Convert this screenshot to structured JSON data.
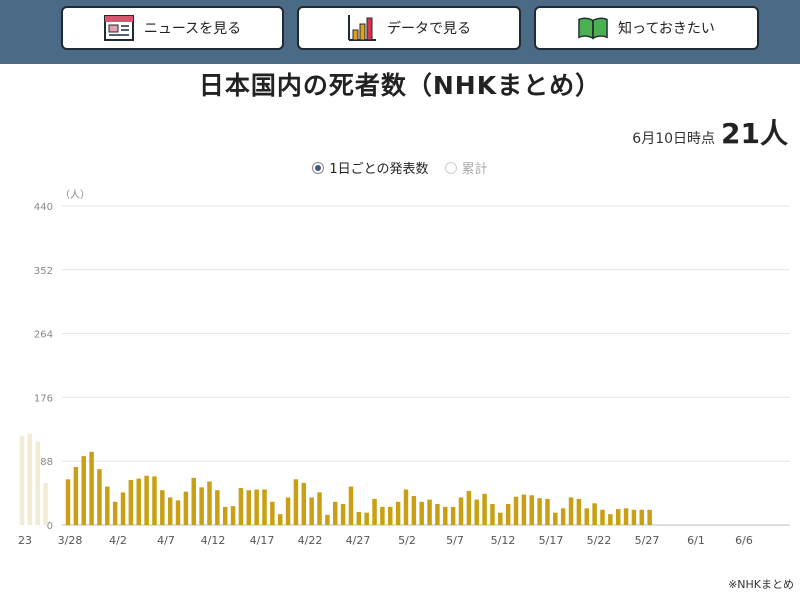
{
  "nav": {
    "news_label": "ニュースを見る",
    "data_label": "データで見る",
    "know_label": "知っておきたい",
    "colors": {
      "bar": "#4b6a85",
      "button_border": "#1e2a35"
    }
  },
  "title": "日本国内の死者数（NHKまとめ）",
  "as_of": {
    "label": "6月10日時点",
    "value": "21人"
  },
  "toggle": {
    "daily_label": "1日ごとの発表数",
    "cumulative_label": "累計",
    "selected": "daily"
  },
  "source": "※NHKまとめ",
  "chart_data": {
    "type": "bar",
    "ylabel": "（人）",
    "ylim": [
      0,
      440
    ],
    "yticks": [
      0,
      88,
      176,
      264,
      352,
      440
    ],
    "grid": true,
    "colors": {
      "bar": "#c9a015",
      "faded_bar": "#f2ecd2"
    },
    "x_tick_labels": [
      "23",
      "3/28",
      "4/2",
      "4/7",
      "4/12",
      "4/17",
      "4/22",
      "4/27",
      "5/2",
      "5/7",
      "5/12",
      "5/17",
      "5/22",
      "5/27",
      "6/1",
      "6/6"
    ],
    "faded_values": [
      123,
      126,
      115,
      58
    ],
    "values": [
      63,
      80,
      95,
      101,
      77,
      53,
      32,
      45,
      62,
      64,
      68,
      67,
      48,
      38,
      34,
      46,
      65,
      52,
      60,
      48,
      25,
      26,
      51,
      48,
      49,
      49,
      32,
      15,
      38,
      63,
      58,
      38,
      45,
      14,
      32,
      29,
      53,
      18,
      17,
      36,
      25,
      25,
      32,
      49,
      40,
      32,
      35,
      29,
      25,
      25,
      38,
      47,
      35,
      43,
      29,
      17,
      29,
      39,
      42,
      41,
      37,
      36,
      17,
      23,
      38,
      36,
      23,
      30,
      21,
      15,
      22,
      23,
      21,
      21,
      21
    ]
  }
}
